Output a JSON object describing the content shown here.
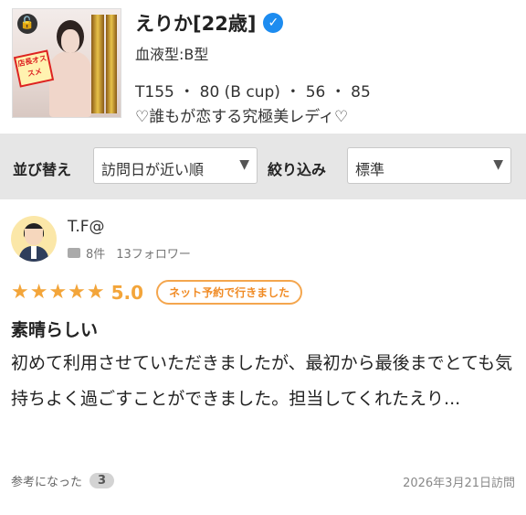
{
  "profile": {
    "name": "えりか[22歳]",
    "blood_type": "血液型:B型",
    "measurements": "T155 ・ 80 (B cup) ・ 56 ・ 85",
    "catchphrase": "♡誰もが恋する究極美レディ♡",
    "verified_icon": "check-badge-icon",
    "thumbnail_badge": "店長オススメ"
  },
  "filters": {
    "sort_label": "並び替え",
    "sort_value": "訪問日が近い順",
    "filter_label": "絞り込み",
    "filter_value": "標準"
  },
  "review": {
    "user": "T.F@",
    "post_count": "8件",
    "followers": "13フォロワー",
    "stars": "★★★★★",
    "score": "5.0",
    "badge": "ネット予約で行きました",
    "title": "素晴らしい",
    "body": "初めて利用させていただきましたが、最初から最後までとても気持ちよく過ごすことができました。担当してくれたえり...",
    "helpful_label": "参考になった",
    "helpful_count": "3",
    "visit_date": "2026年3月21日訪問"
  },
  "colors": {
    "accent_orange": "#f3a53a",
    "verified_blue": "#1d8cf0",
    "filter_bg": "#e6e6e6"
  }
}
